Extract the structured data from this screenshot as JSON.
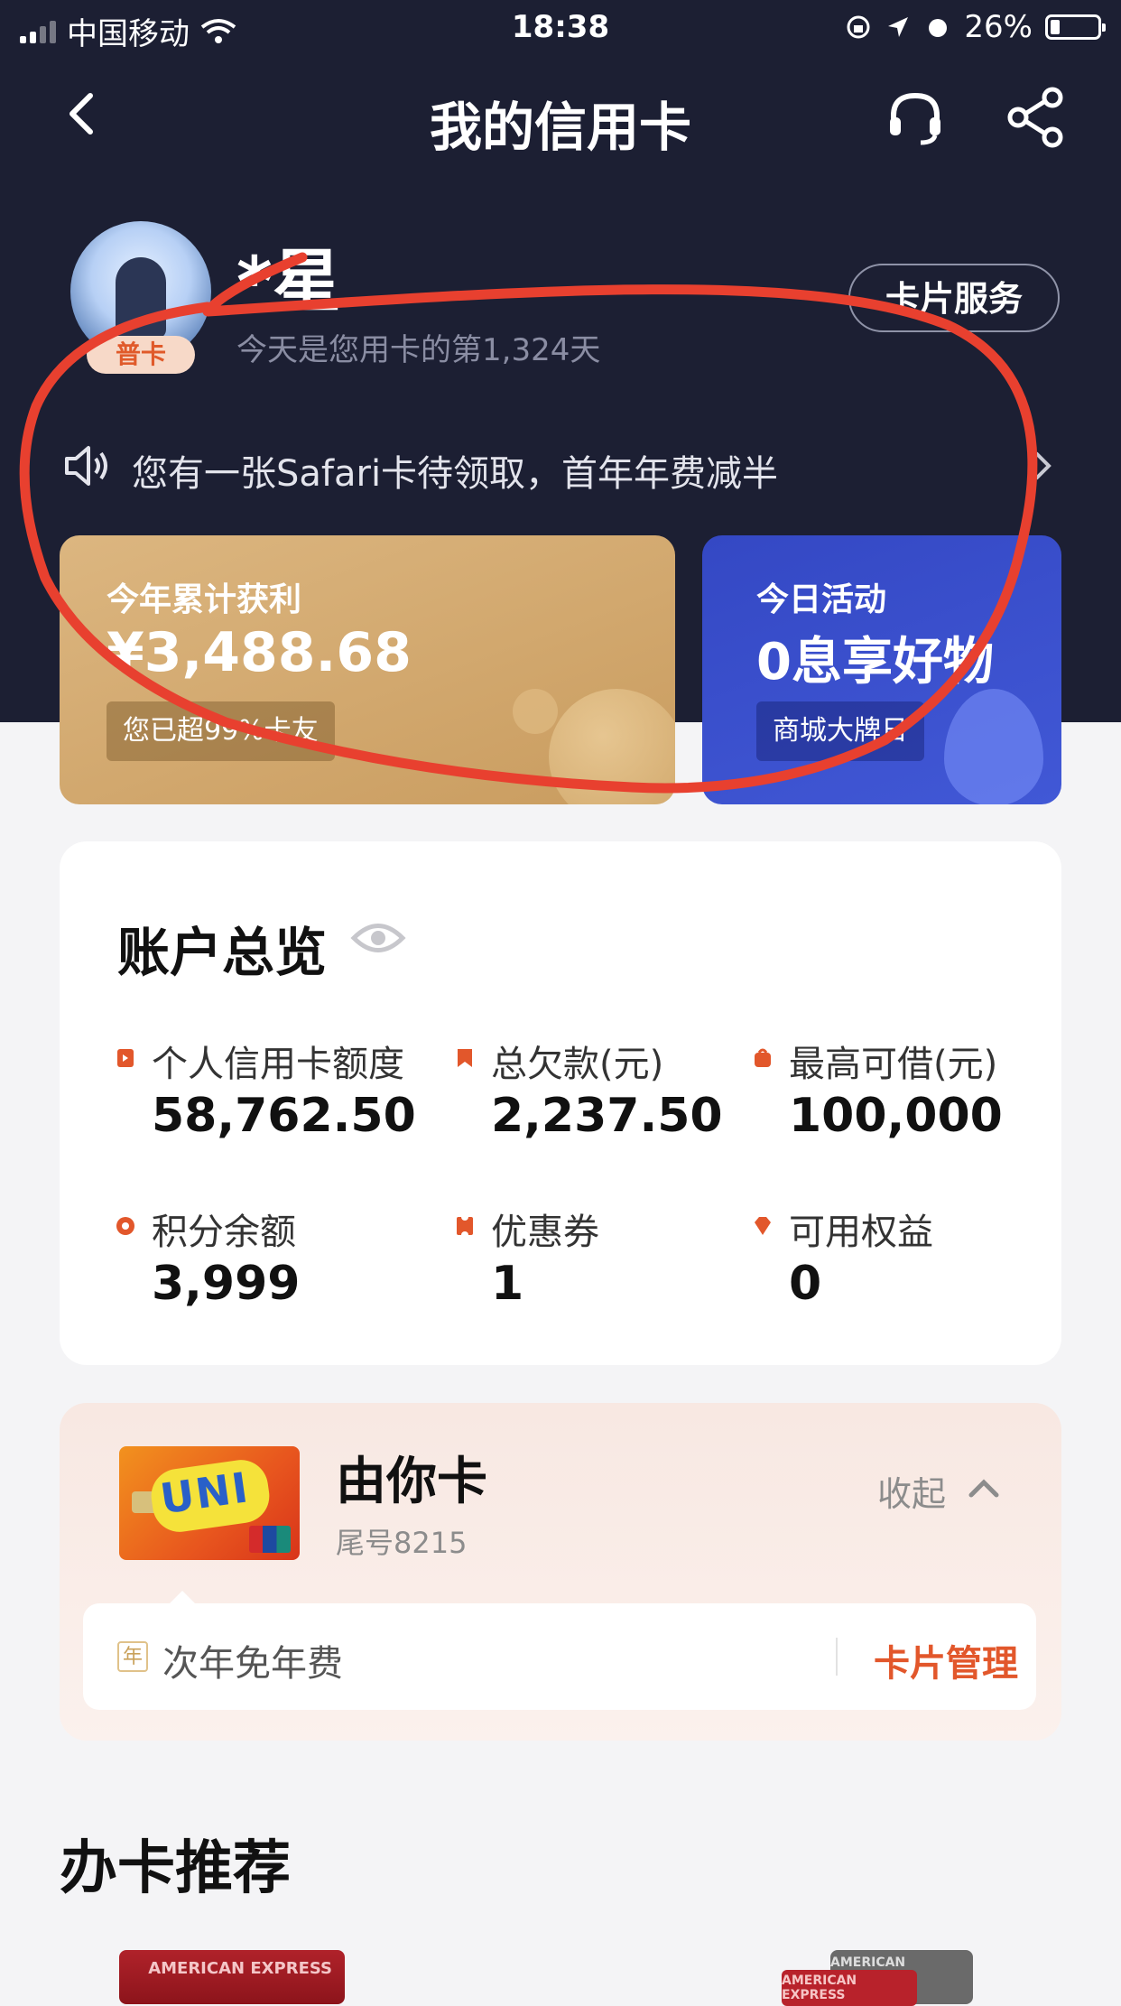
{
  "status_bar": {
    "carrier": "中国移动",
    "time": "18:38",
    "battery": "26%"
  },
  "nav": {
    "title": "我的信用卡"
  },
  "profile": {
    "name": "*星",
    "tier": "普卡",
    "days_text": "今天是您用卡的第1,324天",
    "card_service_label": "卡片服务"
  },
  "notice": {
    "text": "您有一张Safari卡待领取，首年年费减半"
  },
  "promos": {
    "gold": {
      "label": "今年累计获利",
      "value": "¥3,488.68",
      "tag": "您已超99%卡友"
    },
    "blue": {
      "label": "今日活动",
      "value": "0息享好物",
      "tag": "商城大牌日"
    }
  },
  "overview": {
    "title": "账户总览",
    "metrics": [
      {
        "label": "个人信用卡额度",
        "value": "58,762.50",
        "icon": "card-icon",
        "color": "#e2572b"
      },
      {
        "label": "总欠款(元)",
        "value": "2,237.50",
        "icon": "bookmark-icon",
        "color": "#e2572b"
      },
      {
        "label": "最高可借(元)",
        "value": "100,000",
        "icon": "bag-icon",
        "color": "#e2572b"
      },
      {
        "label": "积分余额",
        "value": "3,999",
        "icon": "points-icon",
        "color": "#e2572b"
      },
      {
        "label": "优惠券",
        "value": "1",
        "icon": "coupon-icon",
        "color": "#e2572b"
      },
      {
        "label": "可用权益",
        "value": "0",
        "icon": "diamond-icon",
        "color": "#e2572b"
      }
    ]
  },
  "card": {
    "name": "由你卡",
    "tail": "尾号8215",
    "collapse_label": "收起",
    "fee_badge": "年",
    "fee_text": "次年免年费",
    "manage_label": "卡片管理"
  },
  "recommend": {
    "title": "办卡推荐",
    "card_brand": "AMERICAN EXPRESS"
  },
  "colors": {
    "hero_bg": "#1c1f33",
    "accent": "#e2572b",
    "annotation": "#e8402f"
  }
}
